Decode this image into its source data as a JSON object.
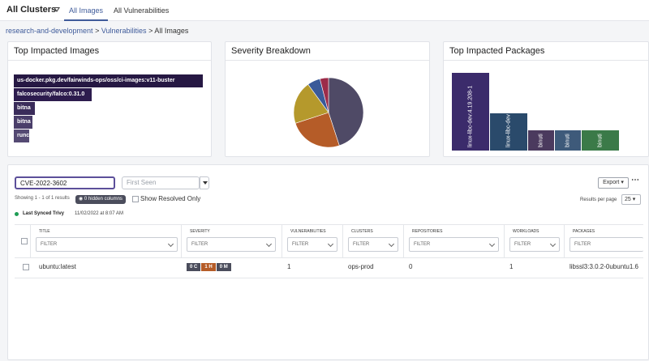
{
  "nav": {
    "cluster_title": "All Clusters",
    "tabs": [
      "All Images",
      "All Vulnerabilities"
    ]
  },
  "breadcrumb": {
    "items": [
      "research-and-development",
      "Vulnerabilities",
      "All Images"
    ]
  },
  "top_images": {
    "title": "Top Impacted Images",
    "bars": [
      {
        "label": "us-docker.pkg.dev/fairwinds-ops/oss/ci-images:v11-buster",
        "value": 100,
        "color": "#261843"
      },
      {
        "label": "falcosecurity/falco:0.31.0",
        "value": 41,
        "color": "#2d1c4e"
      },
      {
        "label": "bitna",
        "value": 11,
        "color": "#3a2c5a"
      },
      {
        "label": "bitna",
        "value": 10,
        "color": "#4a3e6a"
      },
      {
        "label": "runc",
        "value": 8,
        "color": "#554a73"
      }
    ]
  },
  "severity": {
    "title": "Severity Breakdown",
    "slices": [
      {
        "value": 45,
        "color": "#4f4a66"
      },
      {
        "value": 25,
        "color": "#b55c28"
      },
      {
        "value": 20,
        "color": "#b5992c"
      },
      {
        "value": 6,
        "color": "#3a5a99"
      },
      {
        "value": 4,
        "color": "#9c2c4a"
      }
    ]
  },
  "top_packages": {
    "title": "Top Impacted Packages",
    "bars": [
      {
        "label": "linux-libc-dev:4.19.208-1",
        "value": 100,
        "color": "#3b2b6b"
      },
      {
        "label": "linux-libc-dev",
        "value": 48,
        "color": "#2a4a6b"
      },
      {
        "label": "binuti",
        "value": 26,
        "color": "#4b3a5e"
      },
      {
        "label": "binuti",
        "value": 26,
        "color": "#3e5a7a"
      },
      {
        "label": "binuti",
        "value": 26,
        "color": "#3b7a48"
      }
    ]
  },
  "filters": {
    "cve_value": "CVE-2022-3602",
    "first_seen_placeholder": "First Seen",
    "showing": "Showing 1 - 1 of 1 results",
    "hidden_columns": "0 hidden columns",
    "show_resolved": "Show Resolved Only",
    "sync_label": "Last Synced Trivy",
    "sync_date": "11/02/2022 at 8:07 AM",
    "export": "Export ▾",
    "results_per_page_label": "Results per page",
    "results_per_page": "25 ▾"
  },
  "table": {
    "filter_placeholder": "FILTER",
    "columns": [
      "Title",
      "Severity",
      "Vulnerabilities",
      "Clusters",
      "Repositories",
      "Workloads",
      "Packages"
    ],
    "rows": [
      {
        "title": "ubuntu:latest",
        "severity": [
          {
            "label": "0 C",
            "color": "#4b4d5c"
          },
          {
            "label": "1 H",
            "color": "#b55c28"
          },
          {
            "label": "0 M",
            "color": "#4b4d5c"
          }
        ],
        "vulnerabilities": "1",
        "clusters": "ops-prod",
        "repositories": "0",
        "workloads": "1",
        "packages": "libssl3:3.0.2-0ubuntu1.6"
      }
    ]
  }
}
